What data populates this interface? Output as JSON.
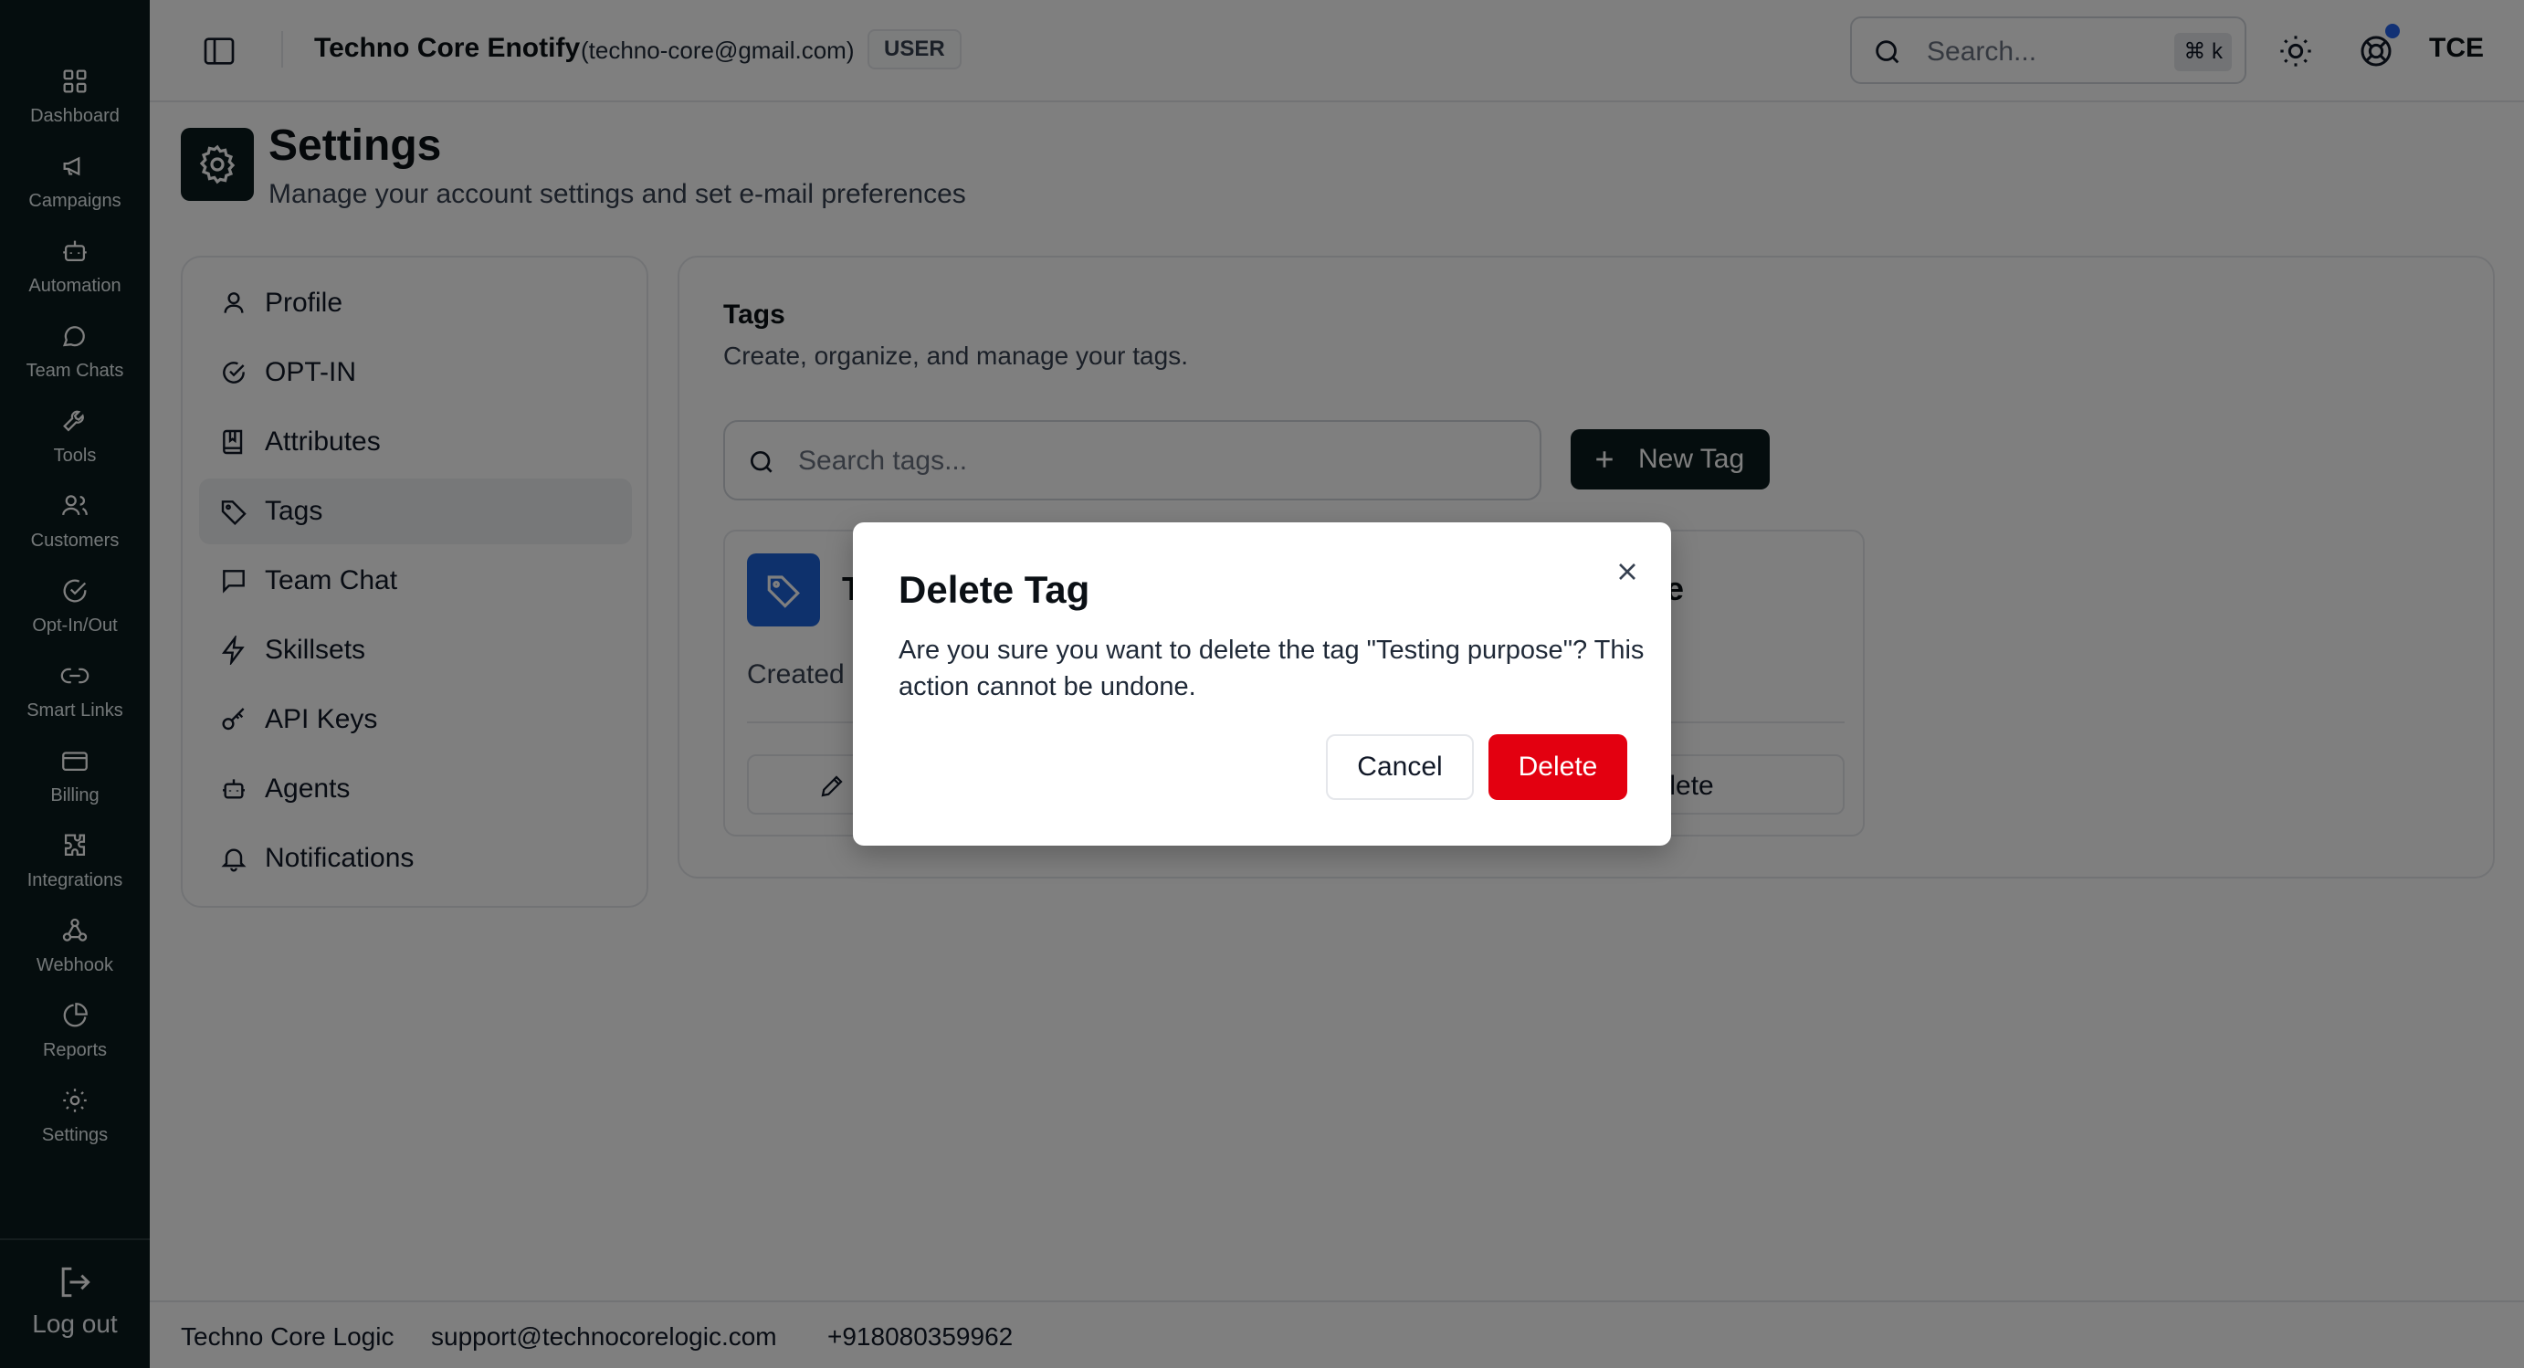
{
  "rail": {
    "items": [
      {
        "label": "Dashboard",
        "icon": "grid-icon"
      },
      {
        "label": "Campaigns",
        "icon": "megaphone-icon"
      },
      {
        "label": "Automation",
        "icon": "bot-icon"
      },
      {
        "label": "Team Chats",
        "icon": "chat-bubble-icon"
      },
      {
        "label": "Tools",
        "icon": "wrench-icon"
      },
      {
        "label": "Customers",
        "icon": "users-icon"
      },
      {
        "label": "Opt-In/Out",
        "icon": "check-circle-icon"
      },
      {
        "label": "Smart Links",
        "icon": "link-icon"
      },
      {
        "label": "Billing",
        "icon": "credit-card-icon"
      },
      {
        "label": "Integrations",
        "icon": "puzzle-icon"
      },
      {
        "label": "Webhook",
        "icon": "webhook-icon"
      },
      {
        "label": "Reports",
        "icon": "pie-chart-icon"
      },
      {
        "label": "Settings",
        "icon": "gear-icon"
      }
    ],
    "logout_label": "Log out"
  },
  "topbar": {
    "org_name": "Techno Core Enotify",
    "org_email": "(techno-core@gmail.com)",
    "role": "USER",
    "search_placeholder": "Search...",
    "shortcut": "⌘ k",
    "avatar": "TCE"
  },
  "page": {
    "title": "Settings",
    "subtitle": "Manage your account settings and set e-mail preferences"
  },
  "settings_nav": {
    "active": "Tags",
    "items": [
      {
        "label": "Profile",
        "icon": "user-icon"
      },
      {
        "label": "OPT-IN",
        "icon": "check-circle-icon"
      },
      {
        "label": "Attributes",
        "icon": "book-icon"
      },
      {
        "label": "Tags",
        "icon": "tag-icon"
      },
      {
        "label": "Team Chat",
        "icon": "message-square-icon"
      },
      {
        "label": "Skillsets",
        "icon": "zap-icon"
      },
      {
        "label": "API Keys",
        "icon": "key-icon"
      },
      {
        "label": "Agents",
        "icon": "bot-icon"
      },
      {
        "label": "Notifications",
        "icon": "bell-icon"
      }
    ]
  },
  "tags": {
    "title": "Tags",
    "subtitle": "Create, organize, and manage your tags.",
    "search_placeholder": "Search tags...",
    "new_button": "New Tag",
    "card": {
      "name_start": "T",
      "name_end": "le",
      "created_prefix": "Created",
      "delete_label": "Delete"
    }
  },
  "dialog": {
    "title": "Delete Tag",
    "message": "Are you sure you want to delete the tag \"Testing purpose\"? This action cannot be undone.",
    "cancel": "Cancel",
    "confirm": "Delete",
    "confirm_color": "#e30010"
  },
  "footer": {
    "company": "Techno Core Logic",
    "email": "support@technocorelogic.com",
    "phone": "+918080359962"
  },
  "colors": {
    "rail_bg": "#0b1a1c",
    "tag_accent": "#1d63d8",
    "notification_dot": "#2563eb"
  }
}
